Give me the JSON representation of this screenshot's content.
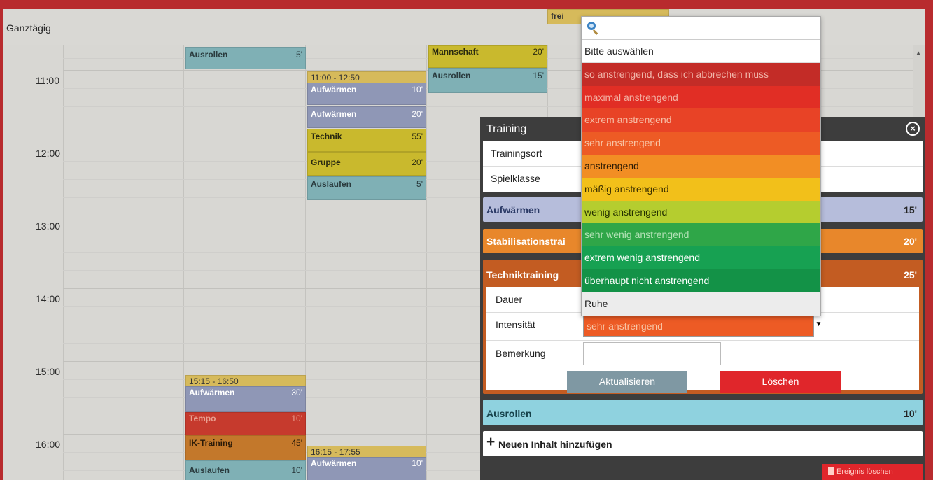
{
  "calendar": {
    "allday_label": "Ganztägig",
    "times": [
      "11:00",
      "12:00",
      "13:00",
      "14:00",
      "15:00",
      "16:00"
    ],
    "allday_event": "frei",
    "events": {
      "ausrollen_1": {
        "name": "Ausrollen",
        "dur": "5'"
      },
      "block_b": {
        "time": "11:00 - 12:50"
      },
      "aufwaermen_b1": {
        "name": "Aufwärmen",
        "dur": "10'"
      },
      "aufwaermen_b2": {
        "name": "Aufwärmen",
        "dur": "20'"
      },
      "technik_b": {
        "name": "Technik",
        "dur": "55'"
      },
      "gruppe_b": {
        "name": "Gruppe",
        "dur": "20'"
      },
      "auslaufen_b": {
        "name": "Auslaufen",
        "dur": "5'"
      },
      "mannschaft_c": {
        "name": "Mannschaft",
        "dur": "20'"
      },
      "ausrollen_c": {
        "name": "Ausrollen",
        "dur": "15'"
      },
      "block_a2": {
        "time": "15:15 - 16:50"
      },
      "aufwaermen_a2": {
        "name": "Aufwärmen",
        "dur": "30'"
      },
      "tempo_a2": {
        "name": "Tempo",
        "dur": "10'"
      },
      "ik_a2": {
        "name": "IK-Training",
        "dur": "45'"
      },
      "auslaufen_a2": {
        "name": "Auslaufen",
        "dur": "10'"
      },
      "block_b2": {
        "time": "16:15 - 17:55"
      },
      "aufwaermen_b3": {
        "name": "Aufwärmen",
        "dur": "10'"
      }
    }
  },
  "panel": {
    "title": "Training",
    "close_icon": "×",
    "trainingsort_label": "Trainingsort",
    "spielklasse_label": "Spielklasse",
    "items": [
      {
        "label": "Aufwärmen",
        "dur": "15'",
        "color": "#b6bddb"
      },
      {
        "label": "Stabilisationstrai",
        "dur": "20'",
        "color": "#e8872b"
      },
      {
        "label": "Techniktraining",
        "dur": "25'",
        "color": "#c35c22"
      }
    ],
    "dauer_label": "Dauer",
    "intensitaet_label": "Intensität",
    "bemerkung_label": "Bemerkung",
    "intensitaet_value": "sehr anstrengend",
    "update_button": "Aktualisieren",
    "delete_button": "Löschen",
    "ausrollen_label": "Ausrollen",
    "ausrollen_dur": "10'",
    "add_content": "Neuen Inhalt hinzufügen",
    "delete_event": "Ereignis löschen"
  },
  "dropdown": {
    "placeholder": "Bitte auswählen",
    "options": [
      {
        "label": "so anstrengend, dass ich abbrechen muss",
        "bg": "#c32c27",
        "fg": "#f0b4a8"
      },
      {
        "label": "maximal anstrengend",
        "bg": "#e12e25",
        "fg": "#f3b1a4"
      },
      {
        "label": "extrem anstrengend",
        "bg": "#e84326",
        "fg": "#f6bda5"
      },
      {
        "label": "sehr anstrengend",
        "bg": "#ed5b25",
        "fg": "#f8c5a5"
      },
      {
        "label": "anstrengend",
        "bg": "#f28e24",
        "fg": "#2b1b05"
      },
      {
        "label": "mäßig anstrengend",
        "bg": "#f2c01a",
        "fg": "#3a2e00"
      },
      {
        "label": "wenig anstrengend",
        "bg": "#b5cd2f",
        "fg": "#233000"
      },
      {
        "label": "sehr wenig anstrengend",
        "bg": "#2fa648",
        "fg": "#b3e2b6"
      },
      {
        "label": "extrem wenig anstrengend",
        "bg": "#17a152",
        "fg": "#ffffff"
      },
      {
        "label": "überhaupt nicht anstrengend",
        "bg": "#139247",
        "fg": "#ffffff"
      },
      {
        "label": "Ruhe",
        "bg": "#ececec",
        "fg": "#222222"
      }
    ]
  }
}
